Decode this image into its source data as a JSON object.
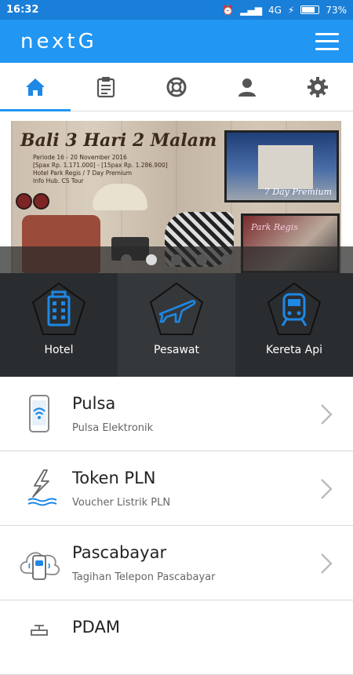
{
  "status_bar": {
    "time": "16:32",
    "network": "4G",
    "battery": "73%",
    "battery_level": 0.73
  },
  "app_bar": {
    "logo": "nextG"
  },
  "tabs": [
    {
      "name": "home",
      "icon": "home-icon",
      "active": true
    },
    {
      "name": "orders",
      "icon": "clipboard-icon",
      "active": false
    },
    {
      "name": "help",
      "icon": "lifebuoy-icon",
      "active": false
    },
    {
      "name": "profile",
      "icon": "user-icon",
      "active": false
    },
    {
      "name": "settings",
      "icon": "gear-icon",
      "active": false
    }
  ],
  "banner": {
    "title": "Bali 3 Hari 2 Malam",
    "info_lines": [
      "Periode 16 - 20 November 2016",
      "[Spax Rp. 1.171.000] - [15pax Rp. 1.286.900]",
      "Hotel Park Regis / 7 Day Premium",
      "Info Hub. CS Tour"
    ],
    "photo1_caption": "7 Day Premium",
    "photo2_caption": "Park Regis",
    "slides": 5,
    "active_slide": 2
  },
  "travel": [
    {
      "label": "Hotel",
      "icon": "hotel-icon"
    },
    {
      "label": "Pesawat",
      "icon": "airplane-icon"
    },
    {
      "label": "Kereta Api",
      "icon": "train-icon"
    }
  ],
  "services": [
    {
      "title": "Pulsa",
      "subtitle": "Pulsa Elektronik",
      "icon": "phone-wifi-icon"
    },
    {
      "title": "Token PLN",
      "subtitle": "Voucher Listrik PLN",
      "icon": "lightning-icon"
    },
    {
      "title": "Pascabayar",
      "subtitle": "Tagihan Telepon Pascabayar",
      "icon": "cloud-phone-icon"
    },
    {
      "title": "PDAM",
      "subtitle": "",
      "icon": "water-tap-icon"
    }
  ],
  "colors": {
    "primary": "#2196f3",
    "status": "#1a7fd8",
    "dark": "#2a2d30",
    "accent_icon": "#1e88e5"
  }
}
